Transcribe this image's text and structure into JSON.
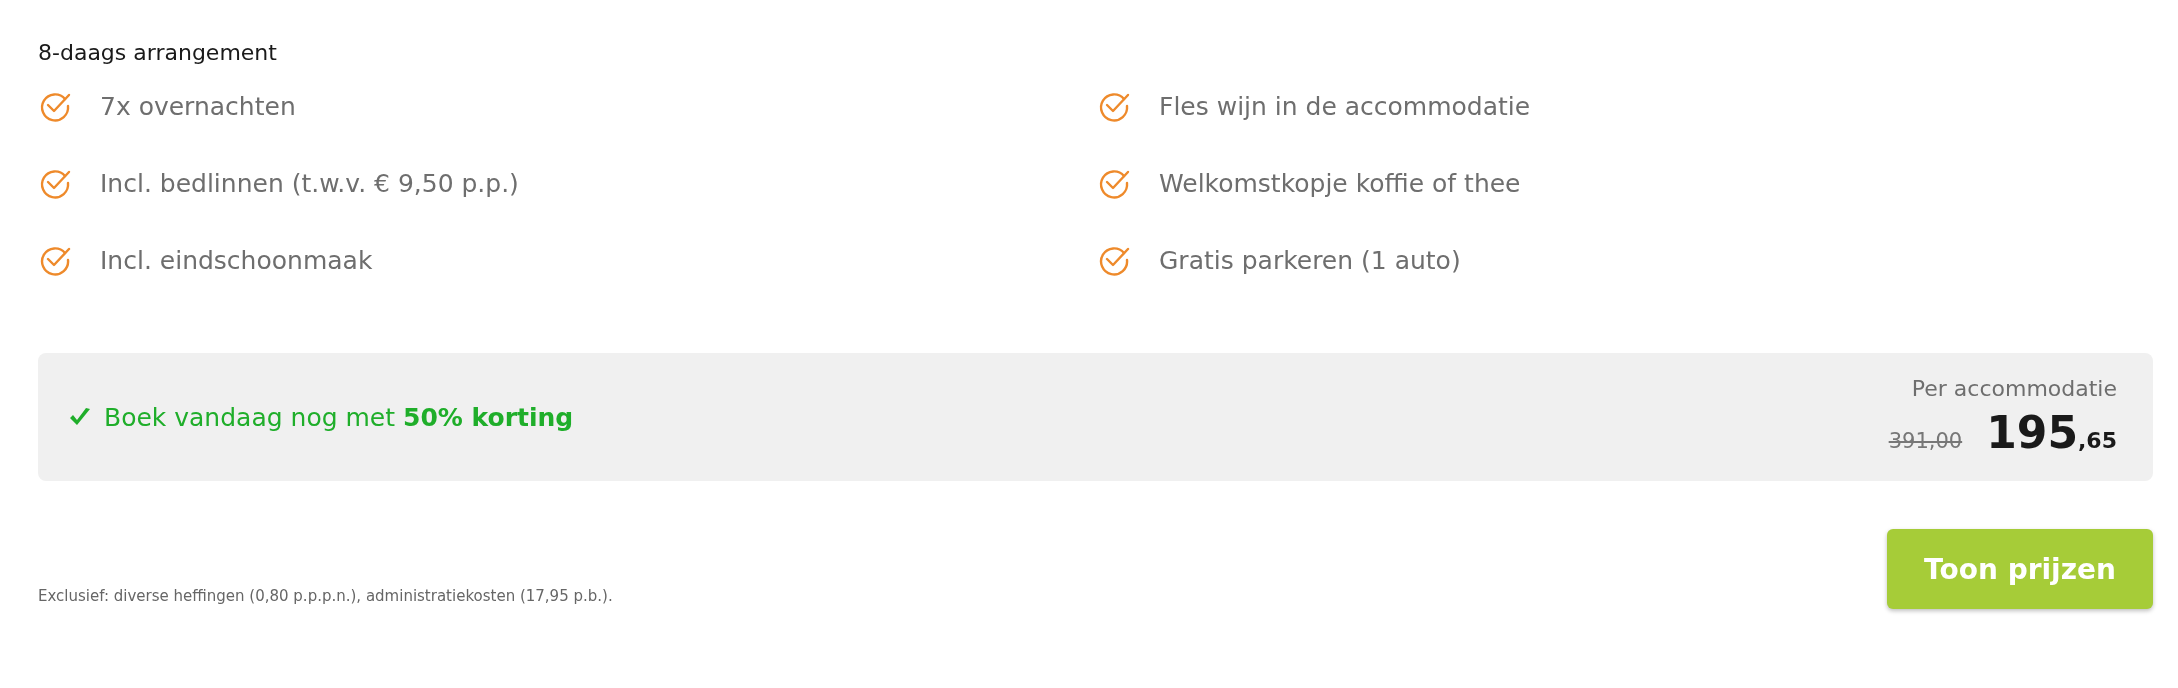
{
  "title": "8-daags arrangement",
  "features": [
    {
      "label": "7x overnachten"
    },
    {
      "label": "Incl. bedlinnen (t.w.v. € 9,50 p.p.)"
    },
    {
      "label": "Incl. eindschoonmaak"
    },
    {
      "label": "Fles wijn in de accommodatie"
    },
    {
      "label": "Welkomstkopje koffie of thee"
    },
    {
      "label": "Gratis parkeren (1 auto)"
    }
  ],
  "offer": {
    "text": "Boek vandaag nog met **50% korting**",
    "price_label": "Per accommodatie",
    "old_price": "391,00",
    "price_whole": "195",
    "price_cents": ",65"
  },
  "footnote": "Exclusief: diverse heffingen (0,80 p.p.p.n.), administratiekosten (17,95 p.b.).",
  "button": "Toon prijzen"
}
